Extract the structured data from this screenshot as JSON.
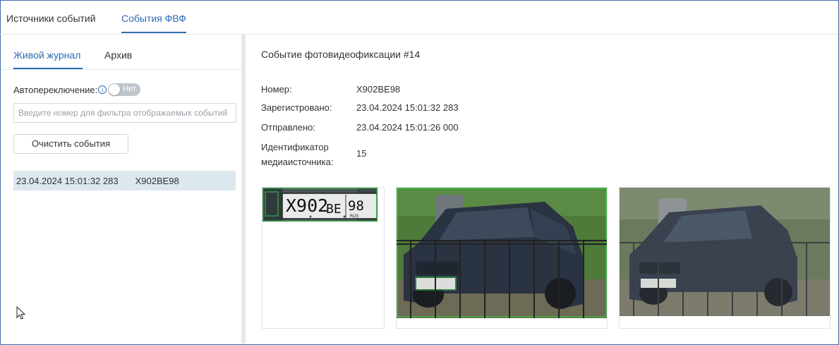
{
  "top_tabs": [
    {
      "label": "Источники событий",
      "active": false
    },
    {
      "label": "События ФВФ",
      "active": true
    }
  ],
  "sub_tabs": [
    {
      "label": "Живой журнал",
      "active": true
    },
    {
      "label": "Архив",
      "active": false
    }
  ],
  "auto_switch": {
    "label": "Автопереключение:",
    "toggle_text": "Нет",
    "enabled": false
  },
  "filter": {
    "placeholder": "Введите номер для фильтра отображаемых событий",
    "value": ""
  },
  "clear_button": "Очистить события",
  "events": [
    {
      "datetime": "23.04.2024 15:01:32 283",
      "plate": "X902BE98",
      "selected": true
    }
  ],
  "details": {
    "title": "Событие фотовидеофиксации #14",
    "fields": [
      {
        "label": "Номер:",
        "value": "X902BE98"
      },
      {
        "label": "Зарегистровано:",
        "value": "23.04.2024 15:01:32 283"
      },
      {
        "label": "Отправлено:",
        "value": "23.04.2024 15:01:26 000"
      },
      {
        "label": "Идентификатор медиаисточника:",
        "value": "15"
      }
    ]
  },
  "plate_image": {
    "text_left": "X902",
    "text_mid": "BE",
    "text_region": "98",
    "country": "RUS"
  },
  "colors": {
    "accent": "#2b6cb0",
    "selected_row": "#dde7ee",
    "detection_box": "#2ecc40"
  },
  "icons": {
    "info": "info-icon",
    "cursor": "mouse-pointer-icon"
  }
}
